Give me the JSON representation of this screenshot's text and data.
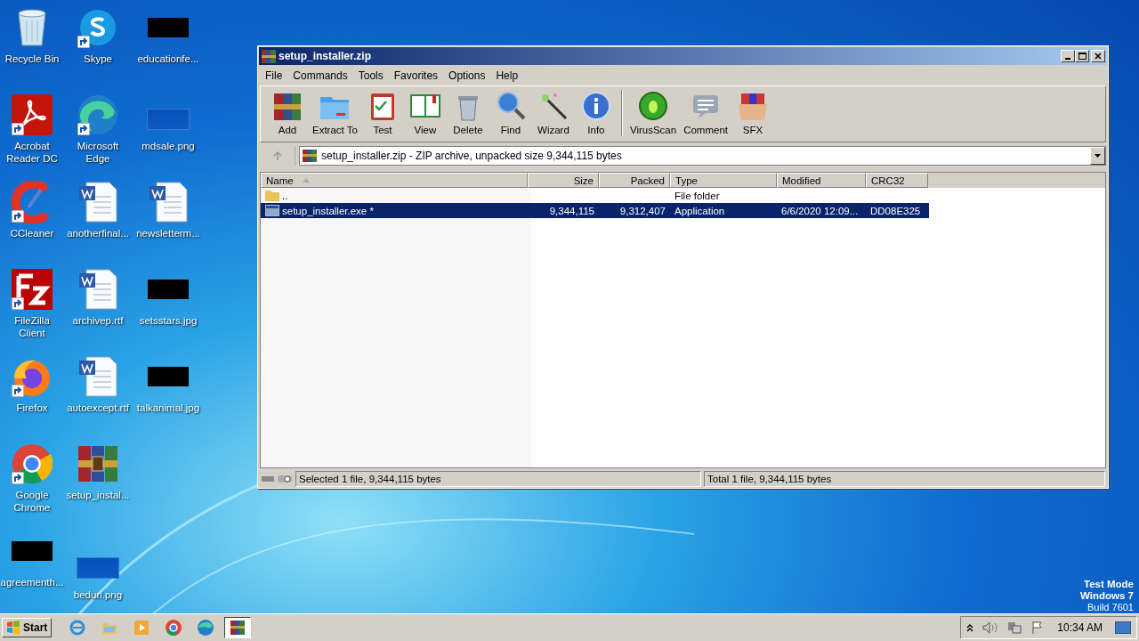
{
  "desktop": {
    "icons": [
      {
        "label": "Recycle Bin",
        "kind": "recycle",
        "shortcut": false
      },
      {
        "label": "Skype",
        "kind": "skype",
        "shortcut": true
      },
      {
        "label": "educationfe...",
        "kind": "redacted",
        "shortcut": false
      },
      {
        "label": "Acrobat Reader DC",
        "kind": "acrobat",
        "shortcut": true
      },
      {
        "label": "Microsoft Edge",
        "kind": "edge",
        "shortcut": true
      },
      {
        "label": "mdsale.png",
        "kind": "image",
        "shortcut": false
      },
      {
        "label": "CCleaner",
        "kind": "ccleaner",
        "shortcut": true
      },
      {
        "label": "anotherfinal...",
        "kind": "word",
        "shortcut": false
      },
      {
        "label": "newsletterm...",
        "kind": "word",
        "shortcut": false
      },
      {
        "label": "FileZilla Client",
        "kind": "filezilla",
        "shortcut": true
      },
      {
        "label": "archivep.rtf",
        "kind": "word",
        "shortcut": false
      },
      {
        "label": "setsstars.jpg",
        "kind": "redacted",
        "shortcut": false
      },
      {
        "label": "Firefox",
        "kind": "firefox",
        "shortcut": true
      },
      {
        "label": "autoexcept.rtf",
        "kind": "word",
        "shortcut": false
      },
      {
        "label": "talkanimal.jpg",
        "kind": "redacted",
        "shortcut": false
      },
      {
        "label": "Google Chrome",
        "kind": "chrome",
        "shortcut": true
      },
      {
        "label": "setup_instal...",
        "kind": "winrar",
        "shortcut": false
      },
      {
        "label": "agreementh...",
        "kind": "redacted",
        "shortcut": false
      },
      {
        "label": "bedurl.png",
        "kind": "image",
        "shortcut": false
      }
    ],
    "test_mode": [
      "Test Mode",
      "Windows 7"
    ],
    "build": "Build 7601"
  },
  "window": {
    "title": "setup_installer.zip",
    "menu": [
      "File",
      "Commands",
      "Tools",
      "Favorites",
      "Options",
      "Help"
    ],
    "toolbar": [
      {
        "label": "Add",
        "kind": "add"
      },
      {
        "label": "Extract To",
        "kind": "extract"
      },
      {
        "label": "Test",
        "kind": "test"
      },
      {
        "label": "View",
        "kind": "view"
      },
      {
        "label": "Delete",
        "kind": "delete"
      },
      {
        "label": "Find",
        "kind": "find"
      },
      {
        "label": "Wizard",
        "kind": "wizard"
      },
      {
        "label": "Info",
        "kind": "info"
      },
      {
        "label": "VirusScan",
        "kind": "virus"
      },
      {
        "label": "Comment",
        "kind": "comment"
      },
      {
        "label": "SFX",
        "kind": "sfx"
      }
    ],
    "address": "setup_installer.zip - ZIP archive, unpacked size 9,344,115 bytes",
    "columns": [
      "Name",
      "Size",
      "Packed",
      "Type",
      "Modified",
      "CRC32"
    ],
    "rows": [
      {
        "kind": "folder",
        "cells": [
          "..",
          "",
          "",
          "File folder",
          "",
          ""
        ],
        "selected": false
      },
      {
        "kind": "exe",
        "cells": [
          "setup_installer.exe *",
          "9,344,115",
          "9,312,407",
          "Application",
          "6/6/2020 12:09...",
          "DD08E325"
        ],
        "selected": true
      }
    ],
    "status_left": "Selected 1 file, 9,344,115 bytes",
    "status_right": "Total 1 file, 9,344,115 bytes"
  },
  "taskbar": {
    "start": "Start",
    "apps": [
      {
        "kind": "ie",
        "selected": false
      },
      {
        "kind": "explorer",
        "selected": false
      },
      {
        "kind": "media",
        "selected": false
      },
      {
        "kind": "chrome",
        "selected": false
      },
      {
        "kind": "edge",
        "selected": false
      },
      {
        "kind": "winrar",
        "selected": true
      }
    ],
    "clock": "10:34 AM"
  }
}
